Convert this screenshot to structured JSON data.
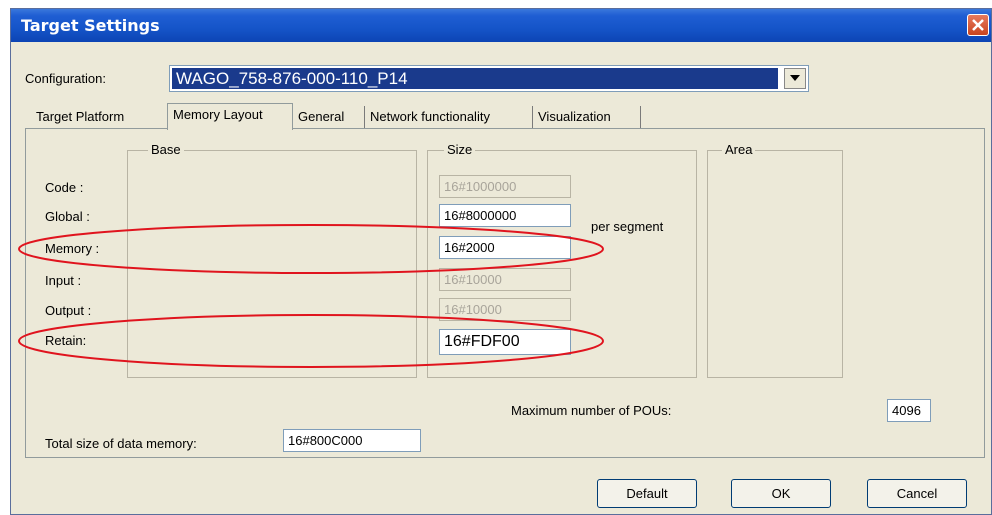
{
  "window": {
    "title": "Target Settings"
  },
  "configuration": {
    "label": "Configuration:",
    "value": "WAGO_758-876-000-110_P14"
  },
  "tabs": [
    {
      "label": "Target Platform",
      "active": false
    },
    {
      "label": "Memory Layout",
      "active": true
    },
    {
      "label": "General",
      "active": false
    },
    {
      "label": "Network functionality",
      "active": false
    },
    {
      "label": "Visualization",
      "active": false
    }
  ],
  "groups": {
    "base": "Base",
    "size": "Size",
    "area": "Area"
  },
  "rows": [
    {
      "label": "Code :",
      "size": "16#1000000",
      "enabled": false
    },
    {
      "label": "Global :",
      "size": "16#8000000",
      "enabled": true,
      "suffix": "per segment"
    },
    {
      "label": "Memory :",
      "size": "16#2000",
      "enabled": true,
      "highlighted": true
    },
    {
      "label": "Input :",
      "size": "16#10000",
      "enabled": false
    },
    {
      "label": "Output :",
      "size": "16#10000",
      "enabled": false
    },
    {
      "label": "Retain:",
      "size": "16#FDF00",
      "enabled": true,
      "highlighted": true
    }
  ],
  "max_pous": {
    "label": "Maximum number of POUs:",
    "value": "4096"
  },
  "total_data_memory": {
    "label": "Total size of data memory:",
    "value": "16#800C000"
  },
  "buttons": {
    "default": "Default",
    "ok": "OK",
    "cancel": "Cancel"
  },
  "colors": {
    "titlebar": "#1554c8",
    "highlight_ellipse": "#e0141e",
    "selection": "#1a3a8c"
  }
}
